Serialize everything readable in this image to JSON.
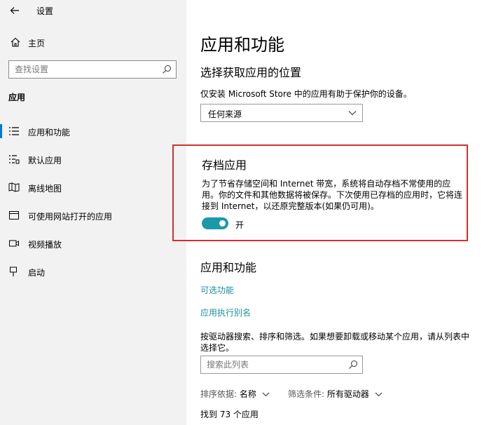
{
  "window": {
    "title": "设置",
    "back_icon": "back-arrow-icon"
  },
  "sidebar": {
    "home_label": "主页",
    "search_placeholder": "查找设置",
    "section": "应用",
    "items": [
      {
        "label": "应用和功能",
        "icon": "list-icon",
        "selected": true
      },
      {
        "label": "默认应用",
        "icon": "default-apps-icon"
      },
      {
        "label": "离线地图",
        "icon": "map-icon"
      },
      {
        "label": "可使用网站打开的应用",
        "icon": "web-app-icon"
      },
      {
        "label": "视频播放",
        "icon": "video-icon"
      },
      {
        "label": "启动",
        "icon": "startup-icon"
      }
    ]
  },
  "main": {
    "title": "应用和功能",
    "location": {
      "heading": "选择获取应用的位置",
      "desc": "仅安装 Microsoft Store 中的应用有助于保护你的设备。",
      "dropdown_value": "任何来源"
    },
    "archive": {
      "heading": "存档应用",
      "desc": "为了节省存储空间和 Internet 带宽，系统将自动存档不常使用的应用。你的文件和其他数据将被保存。下次使用已存档的应用时，它将连接到 Internet，以还原完整版本(如果仍可用)。",
      "toggle_label": "开",
      "toggle_on": true,
      "accent": "#1a9aa8",
      "highlight_color": "#d32f2f"
    },
    "apps": {
      "heading": "应用和功能",
      "link_optional": "可选功能",
      "link_alias": "应用执行别名",
      "desc": "按驱动器搜索、排序和筛选。如果想要卸载或移动某个应用，请从列表中选择它。",
      "search_placeholder": "搜索此列表",
      "sort_key": "排序依据:",
      "sort_value": "名称",
      "filter_key": "筛选条件:",
      "filter_value": "所有驱动器",
      "count": "找到 73 个应用"
    }
  }
}
